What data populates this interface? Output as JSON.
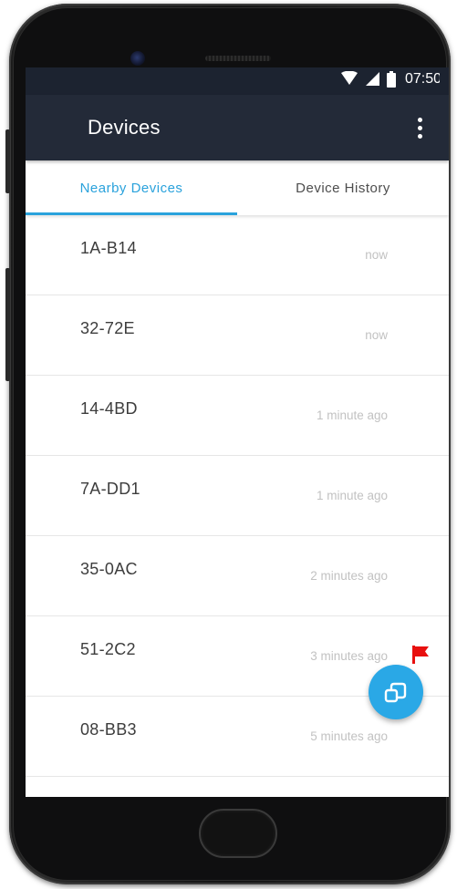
{
  "status_bar": {
    "time": "07:50",
    "icons": [
      "wifi-icon",
      "cell-signal-icon",
      "battery-icon"
    ]
  },
  "app_bar": {
    "title": "Devices",
    "menu_icon": "more-vert-icon"
  },
  "tabs": [
    {
      "label": "Nearby Devices",
      "active": true
    },
    {
      "label": "Device History",
      "active": false
    }
  ],
  "devices": [
    {
      "id": "1A-B14",
      "time": "now",
      "flagged": false
    },
    {
      "id": "32-72E",
      "time": "now",
      "flagged": false
    },
    {
      "id": "14-4BD",
      "time": "1 minute ago",
      "flagged": false
    },
    {
      "id": "7A-DD1",
      "time": "1 minute ago",
      "flagged": false
    },
    {
      "id": "35-0AC",
      "time": "2 minutes ago",
      "flagged": false
    },
    {
      "id": "51-2C2",
      "time": "3 minutes ago",
      "flagged": true
    },
    {
      "id": "08-BB3",
      "time": "5 minutes ago",
      "flagged": false
    }
  ],
  "fab": {
    "icon": "copy-devices-icon"
  },
  "colors": {
    "accent": "#2aa2dc",
    "app_bar": "#232a38",
    "status_bar": "#1c2330",
    "flag": "#e8100f",
    "fab": "#2aa8e6"
  }
}
